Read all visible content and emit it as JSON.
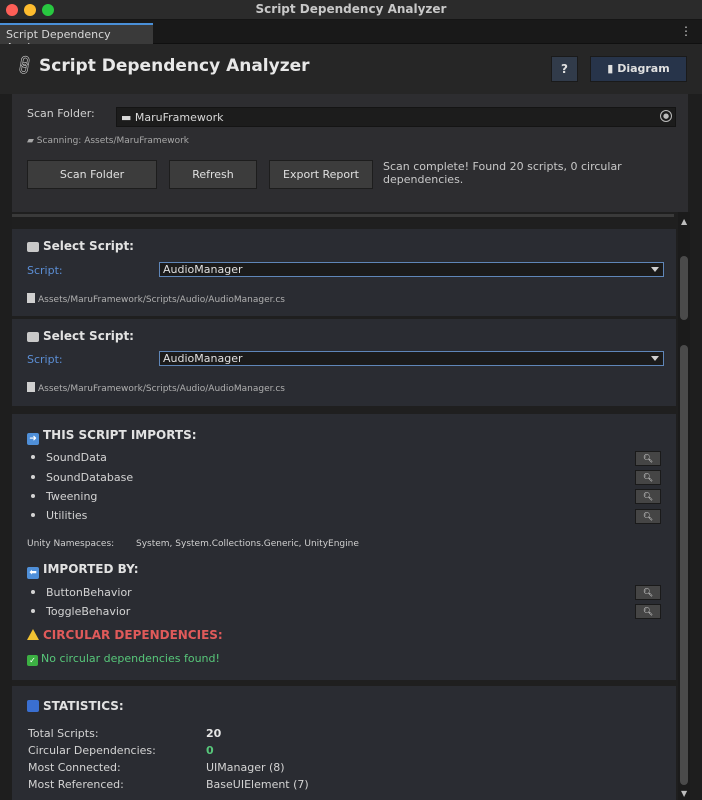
{
  "window": {
    "title": "Script Dependency Analyzer"
  },
  "tab": {
    "label": "Script Dependency Analyzer",
    "menu_glyph": "⋮"
  },
  "header": {
    "title": "Script Dependency Analyzer",
    "help_label": "?",
    "diagram_label": "Diagram"
  },
  "scan": {
    "label": "Scan Folder:",
    "folder_value": "MaruFramework",
    "scanning_text": "Scanning: Assets/MaruFramework",
    "buttons": {
      "scan": "Scan Folder",
      "refresh": "Refresh",
      "export": "Export Report"
    },
    "status": "Scan complete! Found 20 scripts, 0 circular dependencies."
  },
  "select_panels": [
    {
      "title": "Select Script:",
      "script_label": "Script:",
      "selected": "AudioManager",
      "path": "Assets/MaruFramework/Scripts/Audio/AudioManager.cs"
    },
    {
      "title": "Select Script:",
      "script_label": "Script:",
      "selected": "AudioManager",
      "path": "Assets/MaruFramework/Scripts/Audio/AudioManager.cs"
    }
  ],
  "imports": {
    "title": "THIS SCRIPT IMPORTS:",
    "items": [
      "SoundData",
      "SoundDatabase",
      "Tweening",
      "Utilities"
    ],
    "namespaces_label": "Unity Namespaces:",
    "namespaces_value": "System, System.Collections.Generic, UnityEngine"
  },
  "imported_by": {
    "title": "IMPORTED BY:",
    "items": [
      "ButtonBehavior",
      "ToggleBehavior"
    ]
  },
  "circular": {
    "title": "CIRCULAR DEPENDENCIES:",
    "message": "No circular dependencies found!"
  },
  "statistics": {
    "title": "STATISTICS:",
    "rows": [
      {
        "label": "Total Scripts:",
        "value": "20"
      },
      {
        "label": "Circular Dependencies:",
        "value": "0"
      },
      {
        "label": "Most Connected:",
        "value": "UIManager (8)"
      },
      {
        "label": "Most Referenced:",
        "value": "BaseUIElement (7)"
      }
    ]
  },
  "colors": {
    "accent_blue": "#4a90d9",
    "label_blue": "#5c8fd6",
    "error_red": "#e05a5a",
    "success_green": "#57c77a"
  }
}
